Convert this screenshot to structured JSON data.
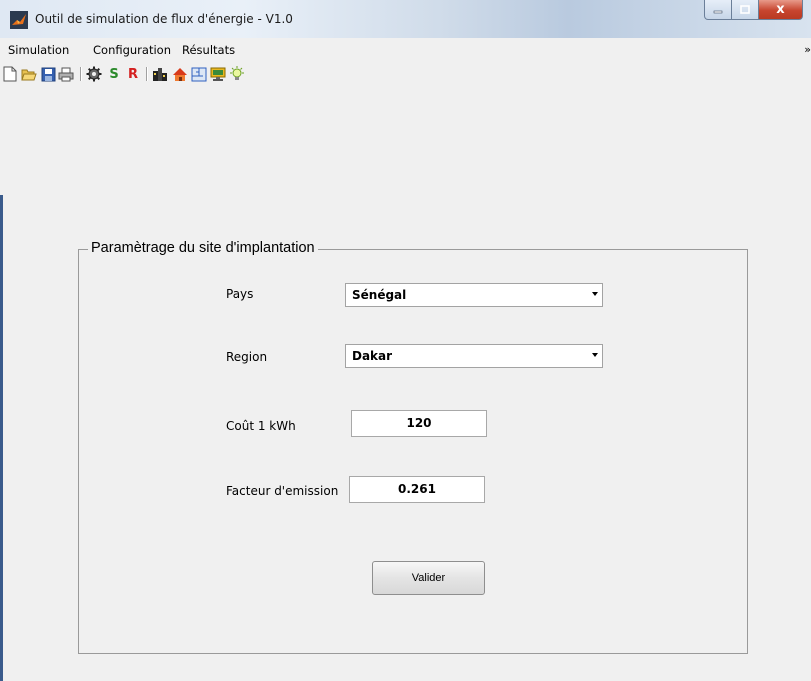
{
  "window": {
    "title": "Outil de simulation de flux d'énergie - V1.0",
    "controls": {
      "minimize": "–",
      "maximize": "□",
      "close": "x"
    }
  },
  "menubar": {
    "items": [
      "Simulation",
      "Configuration",
      "Résultats"
    ],
    "overflow": "»"
  },
  "toolbar": {
    "icons": [
      "new-file-icon",
      "open-folder-icon",
      "save-icon",
      "print-icon",
      "gear-icon",
      "s-icon",
      "r-icon",
      "building-icon",
      "house-icon",
      "floorplan-icon",
      "monitor-icon",
      "lightbulb-icon"
    ],
    "s_label": "S",
    "r_label": "R"
  },
  "panel": {
    "title": "Paramètrage du site d'implantation",
    "pays": {
      "label": "Pays",
      "value": "Sénégal"
    },
    "region": {
      "label": "Region",
      "value": "Dakar"
    },
    "cout": {
      "label": "Coût 1 kWh",
      "value": "120"
    },
    "facteur": {
      "label": "Facteur d'emission",
      "value": "0.261"
    },
    "submit_label": "Valider"
  },
  "colors": {
    "window_bg": "#f0f0f0",
    "close_button": "#c7452f",
    "title_gradient": "#b9cadf"
  }
}
